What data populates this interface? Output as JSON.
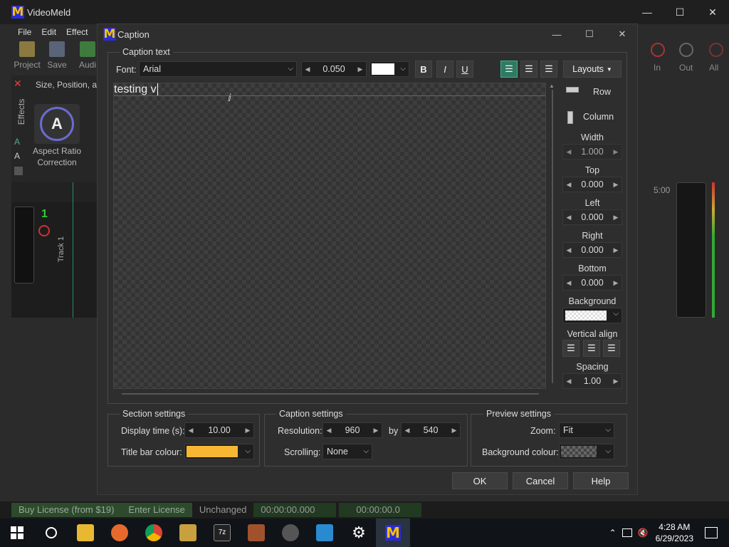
{
  "app": {
    "title": "VideoMeld",
    "menu": [
      "File",
      "Edit",
      "Effect"
    ],
    "toolbar": [
      {
        "label": "Project",
        "icon": "project-icon"
      },
      {
        "label": "Save",
        "icon": "save-icon"
      },
      {
        "label": "Audi",
        "icon": "audio-icon"
      }
    ],
    "effects_tab": "Effects",
    "effects_header": "Size, Position, ar",
    "effect_item": {
      "label": "Aspect Ratio Correction",
      "line1": "Aspect Ratio",
      "line2": "Correction"
    },
    "track": {
      "number": "1",
      "label": "Track 1"
    },
    "timeline_time": "5:00",
    "zoom_buttons": [
      {
        "label": "In",
        "icon": "zoom-in-icon"
      },
      {
        "label": "Out",
        "icon": "zoom-out-icon"
      },
      {
        "label": "All",
        "icon": "zoom-all-icon"
      }
    ]
  },
  "statusbar": {
    "buy": "Buy License (from $19)",
    "enter": "Enter License",
    "state": "Unchanged",
    "time1": "00:00:00.000",
    "time2": "00:00:00.0"
  },
  "dialog": {
    "title": "Caption",
    "caption_group": "Caption text",
    "font_label": "Font:",
    "font_value": "Arial",
    "size_value": "0.050",
    "bold": "B",
    "italic": "I",
    "underline": "U",
    "layouts_button": "Layouts",
    "text_content": "testing v",
    "side": {
      "row": "Row",
      "column": "Column",
      "width_label": "Width",
      "width_value": "1.000",
      "top_label": "Top",
      "top_value": "0.000",
      "left_label": "Left",
      "left_value": "0.000",
      "right_label": "Right",
      "right_value": "0.000",
      "bottom_label": "Bottom",
      "bottom_value": "0.000",
      "background_label": "Background",
      "valign_label": "Vertical align",
      "spacing_label": "Spacing",
      "spacing_value": "1.00"
    },
    "section": {
      "title": "Section settings",
      "display_time_label": "Display time (s):",
      "display_time_value": "10.00",
      "titlebar_colour_label": "Title bar colour:",
      "titlebar_colour": "#f7b733"
    },
    "caption_settings": {
      "title": "Caption settings",
      "resolution_label": "Resolution:",
      "res_w": "960",
      "by_label": "by",
      "res_h": "540",
      "scrolling_label": "Scrolling:",
      "scrolling_value": "None"
    },
    "preview": {
      "title": "Preview settings",
      "zoom_label": "Zoom:",
      "zoom_value": "Fit",
      "bg_colour_label": "Background colour:"
    },
    "ok": "OK",
    "cancel": "Cancel",
    "help": "Help"
  },
  "taskbar": {
    "time": "4:28 AM",
    "date": "6/29/2023",
    "apps": [
      "start-icon",
      "search-icon",
      "file-explorer-icon",
      "firefox-icon",
      "chrome-icon",
      "app-icon",
      "7zip-icon",
      "archive-icon",
      "media-player-icon",
      "remote-icon",
      "settings-icon",
      "videomeld-icon"
    ]
  },
  "colors": {
    "accent": "#2f9e7a",
    "text_color_swatch": "#ffffff"
  }
}
